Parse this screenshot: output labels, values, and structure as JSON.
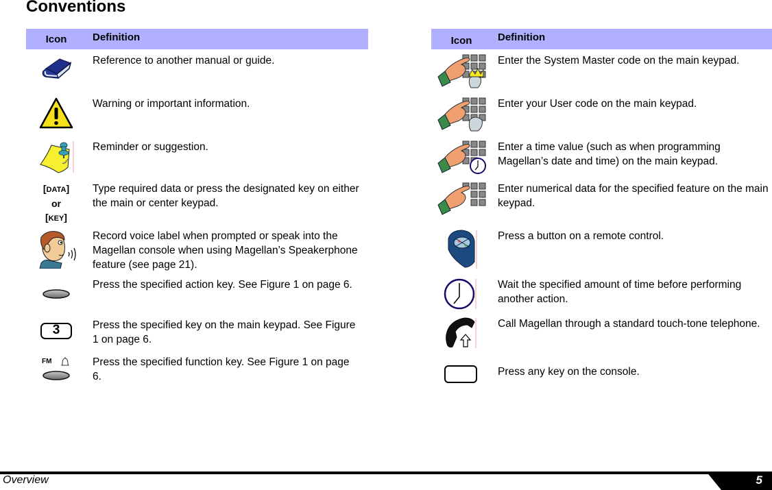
{
  "page": {
    "title": "Conventions",
    "footer": {
      "section": "Overview",
      "page_number": "5"
    }
  },
  "colors": {
    "header_bg": "#b0b0ff",
    "footer_bar": "#000000"
  },
  "left_table": {
    "headers": {
      "icon": "Icon",
      "definition": "Definition"
    },
    "rows": [
      {
        "icon": "book-icon",
        "definition": "Reference to another manual or guide."
      },
      {
        "icon": "warning-icon",
        "definition": "Warning or important information."
      },
      {
        "icon": "pinned-note-icon",
        "definition": "Reminder or suggestion."
      },
      {
        "icon": "data-key-text",
        "icon_text": {
          "line1_open": "[",
          "line1": "DATA",
          "line1_close": "]",
          "line2": "or",
          "line3_open": "[",
          "line3": "KEY",
          "line3_close": "]"
        },
        "definition": "Type required data or press the designated key on either the main or center keypad."
      },
      {
        "icon": "speaking-person-icon",
        "definition": "Record voice label when prompted or speak into the Magellan console when using Magellan’s Speakerphone feature (see page 21)."
      },
      {
        "icon": "action-key-icon",
        "definition": "Press the specified action key. See Figure 1 on page 6."
      },
      {
        "icon": "number-key-icon",
        "icon_text": "3",
        "definition": "Press the specified key on the main keypad. See Figure 1 on page 6."
      },
      {
        "icon": "function-key-icon",
        "icon_text": "FM",
        "definition": "Press the specified function key. See Figure 1 on page 6."
      }
    ]
  },
  "right_table": {
    "headers": {
      "icon": "Icon",
      "definition": "Definition"
    },
    "rows": [
      {
        "icon": "keypad-master-icon",
        "definition": "Enter the System Master code on the main keypad."
      },
      {
        "icon": "keypad-user-icon",
        "definition": "Enter your User code on the main keypad."
      },
      {
        "icon": "keypad-time-icon",
        "definition": "Enter a time value (such as when programming Magellan’s date and time) on the main keypad."
      },
      {
        "icon": "keypad-icon",
        "definition": "Enter numerical data for the specified feature on the main keypad."
      },
      {
        "icon": "remote-control-icon",
        "definition": "Press a button on a remote control."
      },
      {
        "icon": "clock-icon",
        "definition": "Wait the specified amount of time before performing another action."
      },
      {
        "icon": "telephone-icon",
        "definition": "Call Magellan through a standard touch-tone telephone."
      },
      {
        "icon": "any-key-icon",
        "definition": "Press any key on the console."
      }
    ]
  }
}
